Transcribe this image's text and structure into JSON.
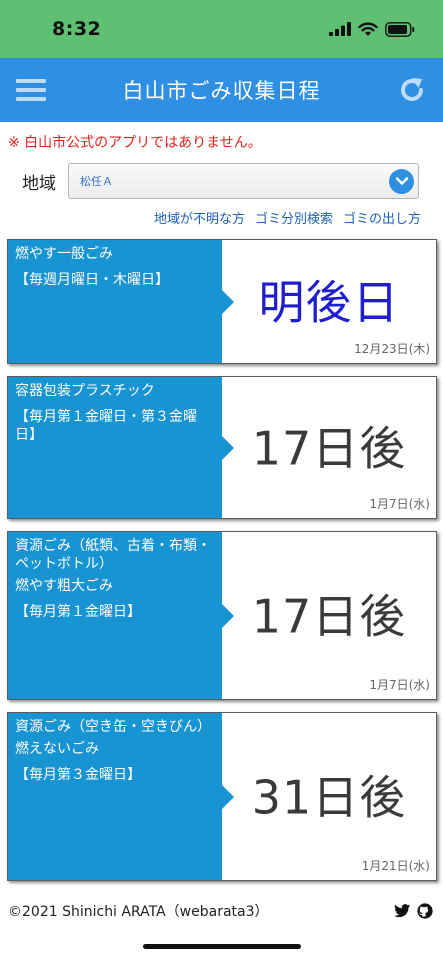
{
  "status_bar": {
    "time": "8:32"
  },
  "header": {
    "title": "白山市ごみ収集日程"
  },
  "notice": "※ 白山市公式のアプリではありません。",
  "area": {
    "label": "地域",
    "selected": "松任Ａ"
  },
  "links": [
    "地域が不明な方",
    "ゴミ分別検索",
    "ゴミの出し方"
  ],
  "cards": [
    {
      "lines": [
        "燃やす一般ごみ",
        "【毎週月曜日・木曜日】"
      ],
      "countdown": "明後日",
      "date": "12月23日(木)"
    },
    {
      "lines": [
        "容器包装プラスチック",
        "【毎月第１金曜日・第３金曜日】"
      ],
      "countdown": "17日後",
      "date": "1月7日(水)"
    },
    {
      "lines": [
        "資源ごみ（紙類、古着・布類・ペットボトル）",
        "燃やす粗大ごみ",
        "【毎月第１金曜日】"
      ],
      "countdown": "17日後",
      "date": "1月7日(水)"
    },
    {
      "lines": [
        "資源ごみ（空き缶・空きびん）",
        "燃えないごみ",
        "【毎月第３金曜日】"
      ],
      "countdown": "31日後",
      "date": "1月21日(水)"
    }
  ],
  "footer": {
    "copyright": "©2021 Shinichi ARATA（webarata3）"
  },
  "colors": {
    "status_bar": "#5fc074",
    "header": "#2f8fe3",
    "card_accent": "#1994d2",
    "notice": "#e0221c",
    "near_countdown": "#1e1ecf"
  }
}
